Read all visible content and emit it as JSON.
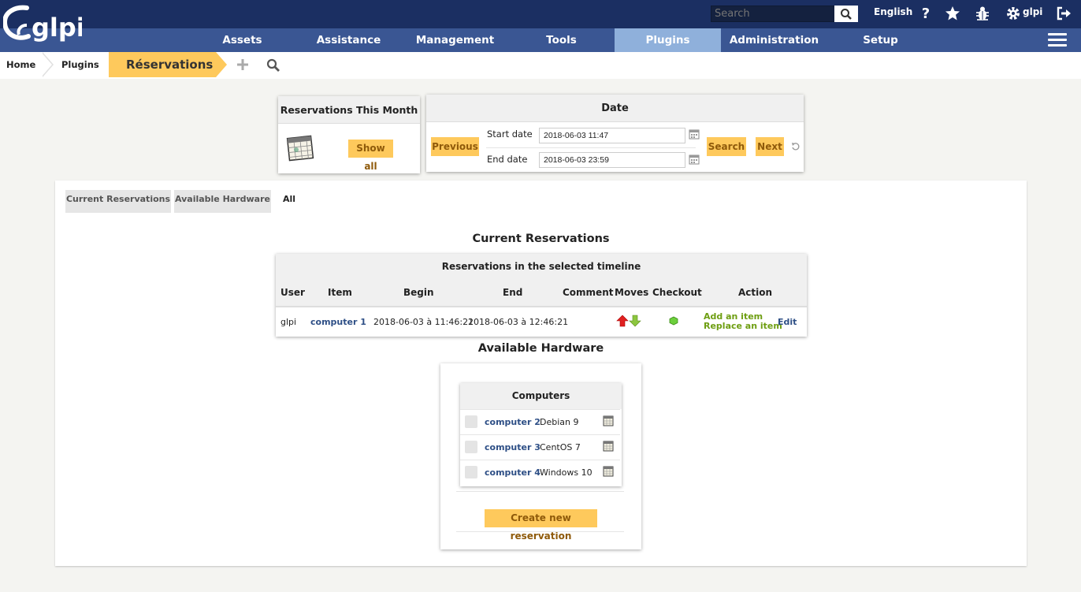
{
  "header": {
    "logo_text": "glpi",
    "search_placeholder": "Search",
    "language": "English",
    "user": "glpi"
  },
  "menu": {
    "items": [
      {
        "label": "Assets"
      },
      {
        "label": "Assistance"
      },
      {
        "label": "Management"
      },
      {
        "label": "Tools"
      },
      {
        "label": "Plugins"
      },
      {
        "label": "Administration"
      },
      {
        "label": "Setup"
      }
    ],
    "active": "Plugins"
  },
  "breadcrumb": {
    "items": [
      "Home",
      "Plugins"
    ],
    "current": "Réservations"
  },
  "month_panel": {
    "title": "Reservations This Month",
    "show_all": "Show all"
  },
  "date_panel": {
    "title": "Date",
    "previous": "Previous",
    "start_label": "Start date",
    "start_value": "2018-06-03 11:47",
    "end_label": "End date",
    "end_value": "2018-06-03 23:59",
    "search": "Search",
    "next": "Next"
  },
  "tabs": [
    "Current Reservations",
    "Available Hardware",
    "All"
  ],
  "current_reservations": {
    "title": "Current Reservations",
    "table_title": "Reservations in the selected timeline",
    "headers": [
      "User",
      "Item",
      "Begin",
      "End",
      "Comment",
      "Moves",
      "Checkout",
      "Action"
    ],
    "rows": [
      {
        "user": "glpi",
        "item": "computer 1",
        "begin": "2018-06-03 à 11:46:21",
        "end": "2018-06-03 à 12:46:21",
        "comment": "",
        "add_item": "Add an item",
        "replace_item": "Replace an item",
        "edit": "Edit"
      }
    ]
  },
  "available_hardware": {
    "title": "Available Hardware",
    "group_title": "Computers",
    "rows": [
      {
        "name": "computer 2",
        "os": "Debian 9"
      },
      {
        "name": "computer 3",
        "os": "CentOS 7"
      },
      {
        "name": "computer 4",
        "os": "Windows 10"
      }
    ],
    "create_button": "Create new reservation"
  },
  "colors": {
    "header_bg": "#1b2f62",
    "menu_bg": "#3a5693",
    "menu_active": "#8fb0db",
    "accent_yellow": "#fec95c",
    "link_blue": "#2e4f86",
    "link_green": "#6e9e12"
  }
}
